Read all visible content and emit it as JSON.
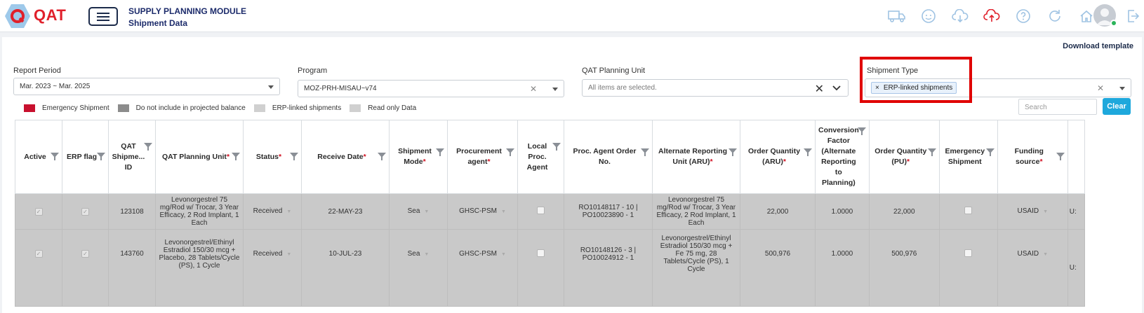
{
  "header": {
    "logo_text": "QAT",
    "module_title": "SUPPLY PLANNING MODULE",
    "page_title": "Shipment Data",
    "icons": [
      "truck-icon",
      "person-icon",
      "cloud-download-icon",
      "cloud-upload-icon",
      "help-icon",
      "refresh-icon",
      "home-icon"
    ],
    "accent": "#e0202b"
  },
  "toolbar": {
    "download_label": "Download template"
  },
  "filters": {
    "report_period": {
      "label": "Report Period",
      "value": "Mar. 2023 ~ Mar. 2025"
    },
    "program": {
      "label": "Program",
      "value": "MOZ-PRH-MISAU~v74"
    },
    "planning_unit": {
      "label": "QAT Planning Unit",
      "value": "All items are selected."
    },
    "shipment_type": {
      "label": "Shipment Type",
      "tag": "ERP-linked shipments"
    }
  },
  "legend": {
    "items": [
      {
        "label": "Emergency Shipment",
        "color": "#c8102e"
      },
      {
        "label": "Do not include in projected balance",
        "color": "#8c8c8c"
      },
      {
        "label": "ERP-linked shipments",
        "color": "#d0d0d0"
      },
      {
        "label": "Read only Data",
        "color": "#d0d0d0"
      }
    ]
  },
  "search": {
    "placeholder": "Search",
    "clear_label": "Clear"
  },
  "table": {
    "columns": [
      {
        "label": "Active",
        "required": false
      },
      {
        "label": "ERP flag",
        "required": false
      },
      {
        "label": "QAT Shipme... ID",
        "required": false
      },
      {
        "label": "QAT Planning Unit",
        "required": true
      },
      {
        "label": "Status",
        "required": true
      },
      {
        "label": "Receive Date",
        "required": true
      },
      {
        "label": "Shipment Mode",
        "required": true
      },
      {
        "label": "Procurement agent",
        "required": true
      },
      {
        "label": "Local Proc. Agent",
        "required": false
      },
      {
        "label": "Proc. Agent Order No.",
        "required": false
      },
      {
        "label": "Alternate Reporting Unit (ARU)",
        "required": true
      },
      {
        "label": "Order Quantity (ARU)",
        "required": true
      },
      {
        "label": "Conversion Factor (Alternate Reporting to Planning)",
        "required": false
      },
      {
        "label": "Order Quantity (PU)",
        "required": true
      },
      {
        "label": "Emergency Shipment",
        "required": false
      },
      {
        "label": "Funding source",
        "required": true
      }
    ],
    "rows": [
      {
        "id": "123108",
        "planning_unit": "Levonorgestrel 75 mg/Rod w/ Trocar, 3 Year Efficacy, 2 Rod Implant, 1 Each",
        "status": "Received",
        "receive_date": "22-MAY-23",
        "mode": "Sea",
        "agent": "GHSC-PSM",
        "order_no": "RO10148117 - 10 | PO10023890 - 1",
        "aru": "Levonorgestrel 75 mg/Rod w/ Trocar, 3 Year Efficacy, 2 Rod Implant, 1 Each",
        "qty_aru": "22,000",
        "conversion": "1.0000",
        "qty_pu": "22,000",
        "funding": "USAID",
        "overflow": "U:"
      },
      {
        "id": "143760",
        "planning_unit": "Levonorgestrel/Ethinyl Estradiol 150/30 mcg + Placebo, 28 Tablets/Cycle (PS), 1 Cycle",
        "status": "Received",
        "receive_date": "10-JUL-23",
        "mode": "Sea",
        "agent": "GHSC-PSM",
        "order_no": "RO10148126 - 3 | PO10024912 - 1",
        "aru": "Levonorgestrel/Ethinyl Estradiol 150/30 mcg + Fe 75 mg, 28 Tablets/Cycle (PS), 1 Cycle",
        "qty_aru": "500,976",
        "conversion": "1.0000",
        "qty_pu": "500,976",
        "funding": "USAID",
        "overflow": "U:"
      }
    ]
  }
}
